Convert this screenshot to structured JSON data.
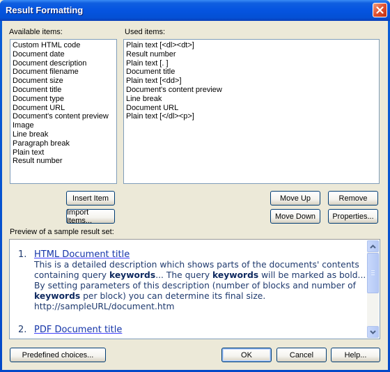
{
  "window": {
    "title": "Result Formatting"
  },
  "available": {
    "label": "Available items:",
    "items": [
      "Custom HTML code",
      "Document date",
      "Document description",
      "Document filename",
      "Document size",
      "Document title",
      "Document type",
      "Document URL",
      "Document's content preview",
      "Image",
      "Line break",
      "Paragraph break",
      "Plain text",
      "Result number"
    ]
  },
  "used": {
    "label": "Used items:",
    "items": [
      "Plain text [<dl><dt>]",
      "Result number",
      "Plain text [. ]",
      "Document title",
      "Plain text [<dd>]",
      "Document's content preview",
      "Line break",
      "Document URL",
      "Plain text [</dl><p>]"
    ]
  },
  "buttons": {
    "insert_item": "Insert Item",
    "import_items": "Import Items...",
    "move_up": "Move Up",
    "move_down": "Move Down",
    "remove": "Remove",
    "properties": "Properties...",
    "predefined": "Predefined choices...",
    "ok": "OK",
    "cancel": "Cancel",
    "help": "Help..."
  },
  "preview": {
    "label": "Preview of a sample result set:",
    "results": [
      {
        "number": "1.",
        "title": "HTML Document title",
        "desc_parts": [
          {
            "t": "This is a detailed description which shows parts of the documents' contents containing query ",
            "b": false
          },
          {
            "t": "keywords",
            "b": true
          },
          {
            "t": "... The query ",
            "b": false
          },
          {
            "t": "keywords",
            "b": true
          },
          {
            "t": " will be marked as bold... By setting parameters of this description (number of blocks and number of ",
            "b": false
          },
          {
            "t": "keywords",
            "b": true
          },
          {
            "t": " per block) you can determine its final size.",
            "b": false
          }
        ],
        "url": "http://sampleURL/document.htm"
      },
      {
        "number": "2.",
        "title": "PDF Document title"
      }
    ]
  },
  "colors": {
    "titlebar": "#0554e0",
    "face": "#ece9d8",
    "link": "#1535a8",
    "preview_text": "#1f3a6e"
  }
}
